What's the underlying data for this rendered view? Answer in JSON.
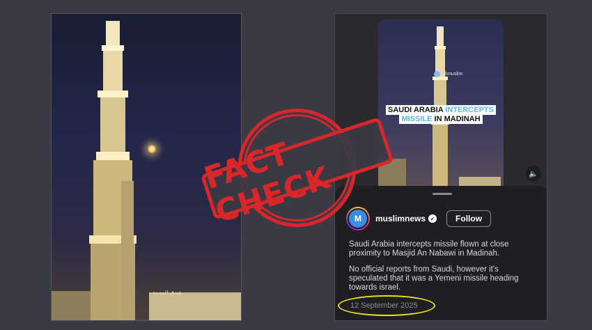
{
  "left_photo": {
    "building_sign": "ﻓﻨﺪﻕ ﺍﻟﻤﺪﻳﻨﺔ"
  },
  "stamp": {
    "text": "FACT CHECK",
    "color": "#d8262a"
  },
  "reel": {
    "handle": "@muslim",
    "headline_line1_dark": "SAUDI ARABIA ",
    "headline_line1_blue": "INTERCEPTS",
    "headline_line2_blue": "MISSILE",
    "headline_line2_dark": " IN MADINAH",
    "sound_icon": "speaker-icon"
  },
  "post": {
    "avatar_letter": "M",
    "username": "muslimnews",
    "verified_icon": "verified-badge-icon",
    "follow_label": "Follow",
    "caption_p1": "Saudi Arabia intercepts missile flown at close proximity to Masjid An Nabawi in Madinah.",
    "caption_p2": "No official reports from Saudi, however it's speculated that it was a Yemeni missile heading towards israel.",
    "date": "12 September 2025",
    "highlight_color": "#e8e020"
  }
}
